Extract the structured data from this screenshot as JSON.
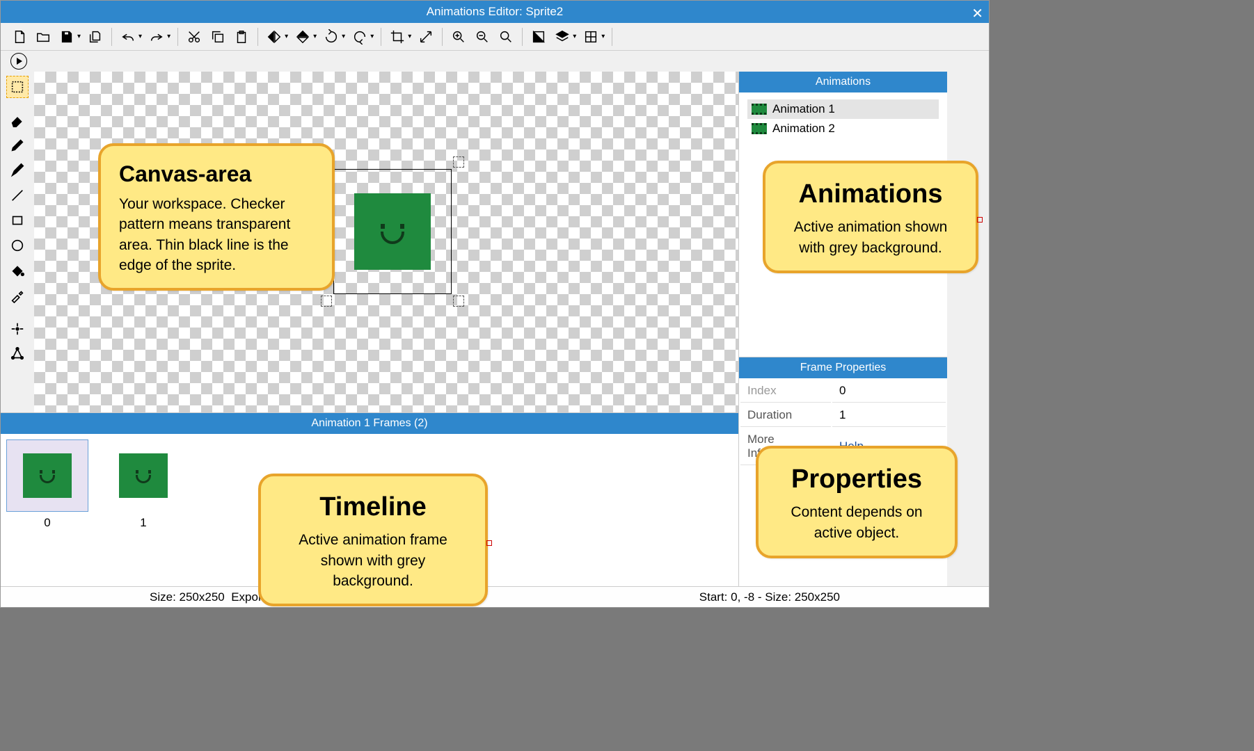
{
  "window_title": "Animations Editor: Sprite2",
  "toolbar": {
    "new": "New",
    "open": "Open",
    "save": "Save",
    "clone": "Clone",
    "undo": "Undo",
    "redo": "Redo",
    "cut": "Cut",
    "copy": "Copy",
    "paste": "Paste",
    "flip_h": "Flip H",
    "flip_v": "Flip V",
    "rotate_ccw": "Rotate CCW",
    "rotate_cw": "Rotate CW",
    "crop": "Crop",
    "resize": "Resize",
    "zoom_in": "Zoom In",
    "zoom_out": "Zoom Out",
    "zoom_fit": "Zoom Fit",
    "mask": "Mask",
    "layers": "Layers",
    "grid": "Grid",
    "play": "Play"
  },
  "side_tools": {
    "select": "Rectangle Select",
    "eraser": "Eraser",
    "pencil": "Pencil",
    "brush": "Brush",
    "line": "Line",
    "rect": "Rectangle",
    "circle": "Circle",
    "fill": "Fill",
    "eyedropper": "Eyedropper",
    "origin": "Origin",
    "polygon": "Collision Polygon"
  },
  "animations_panel": {
    "title": "Animations",
    "items": [
      {
        "label": "Animation 1",
        "selected": true
      },
      {
        "label": "Animation 2",
        "selected": false
      }
    ]
  },
  "frame_props_panel": {
    "title": "Frame Properties",
    "rows": [
      {
        "label": "Index",
        "value": "0"
      },
      {
        "label": "Duration",
        "value": "1"
      },
      {
        "label": "More Information",
        "value": "Help",
        "link": true
      }
    ]
  },
  "timeline": {
    "title": "Animation 1 Frames  (2)",
    "frames": [
      {
        "label": "0",
        "active": true
      },
      {
        "label": "1",
        "active": false
      }
    ]
  },
  "statusbar": {
    "size": "Size: 250x250",
    "export": "Export Format: PNG",
    "start": "Start: 0, -8 - Size: 250x250"
  },
  "callouts": {
    "canvas": {
      "title": "Canvas-area",
      "body": "Your workspace. Checker pattern means transparent area. Thin black line is the edge of the sprite."
    },
    "timeline": {
      "title": "Timeline",
      "body": "Active animation frame shown with grey background."
    },
    "animations": {
      "title": "Animations",
      "body": "Active animation shown with grey background."
    },
    "properties": {
      "title": "Properties",
      "body": "Content depends on active object."
    }
  }
}
